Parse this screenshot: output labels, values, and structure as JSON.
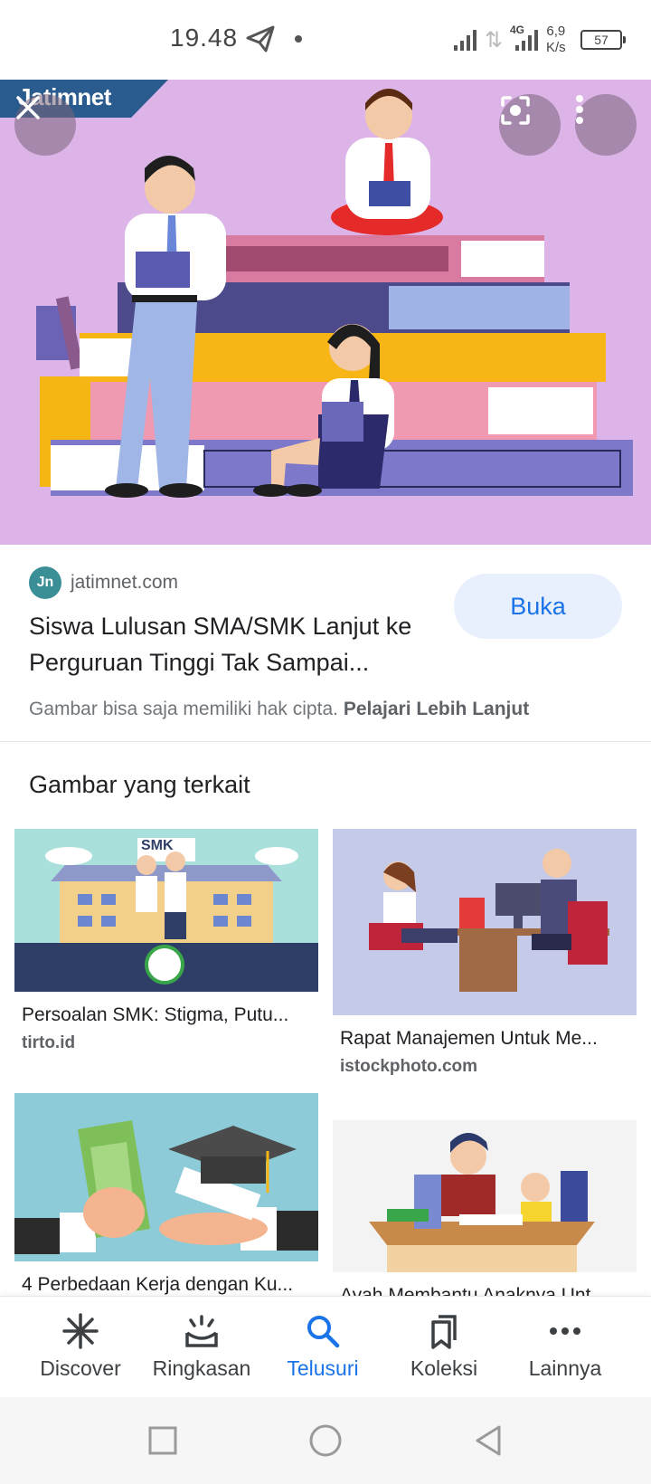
{
  "status_bar": {
    "time": "19.48",
    "network_type": "4G",
    "speed_value": "6,9",
    "speed_unit": "K/s",
    "battery": "57"
  },
  "hero": {
    "site_logo_text": "Jatimnet",
    "colors": {
      "background": "#dcb4e8",
      "logo_tab": "#2a5b8e"
    }
  },
  "info": {
    "source_icon_text": "Jn",
    "source_domain": "jatimnet.com",
    "title": "Siswa Lulusan SMA/SMK Lanjut ke Perguruan Tinggi Tak Sampai...",
    "open_button": "Buka",
    "copyright_text": "Gambar bisa saja memiliki hak cipta.",
    "learn_more": "Pelajari Lebih Lanjut"
  },
  "related": {
    "heading": "Gambar yang terkait",
    "items": [
      {
        "title": "Persoalan SMK: Stigma, Putu...",
        "source": "tirto.id",
        "sign_text": "SMK"
      },
      {
        "title": "Rapat Manajemen Untuk Me...",
        "source": "istockphoto.com"
      },
      {
        "title": "4 Perbedaan Kerja dengan Ku...",
        "source": ""
      },
      {
        "title": "Ayah Membantu Anaknya Unt...",
        "source": ""
      }
    ]
  },
  "bottom_nav": {
    "items": [
      {
        "label": "Discover",
        "icon": "asterisk-icon"
      },
      {
        "label": "Ringkasan",
        "icon": "updates-icon"
      },
      {
        "label": "Telusuri",
        "icon": "search-icon",
        "active": true
      },
      {
        "label": "Koleksi",
        "icon": "bookmarks-icon"
      },
      {
        "label": "Lainnya",
        "icon": "more-horizontal-icon"
      }
    ],
    "accent_color": "#1a73e8"
  }
}
